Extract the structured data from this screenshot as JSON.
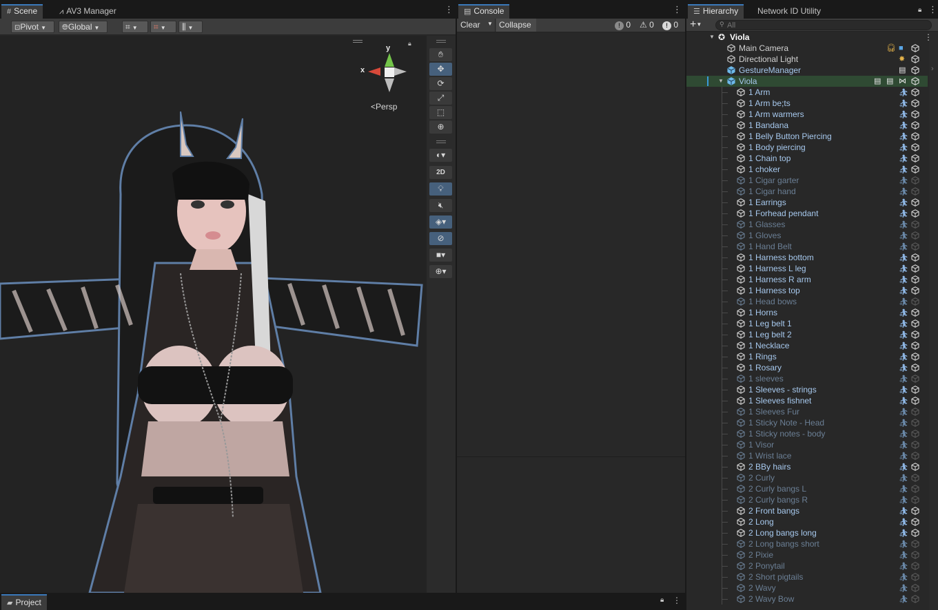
{
  "scene": {
    "tabs": [
      {
        "label": "Scene",
        "icon": "grid-icon"
      },
      {
        "label": "AV3 Manager",
        "icon": "vrc-icon"
      }
    ],
    "toolbar": {
      "pivot": "Pivot",
      "global": "Global"
    },
    "gizmo": {
      "y_label": "y",
      "x_label": "x",
      "projection": "Persp"
    },
    "tools": {
      "mode_2d": "2D"
    }
  },
  "console": {
    "tab": "Console",
    "clear": "Clear",
    "collapse": "Collapse",
    "counts": {
      "info": "0",
      "warning": "0",
      "error": "0"
    }
  },
  "hierarchy": {
    "tabs": [
      "Hierarchy",
      "Network ID Utility"
    ],
    "search_placeholder": "All",
    "scene_name": "Viola",
    "top_items": [
      {
        "label": "Main Camera",
        "style": "normal"
      },
      {
        "label": "Directional Light",
        "style": "normal"
      },
      {
        "label": "GestureManager",
        "style": "active"
      },
      {
        "label": "Viola",
        "style": "active"
      }
    ],
    "children": [
      {
        "label": "1 Arm",
        "on": true
      },
      {
        "label": "1 Arm be;ts",
        "on": true
      },
      {
        "label": "1 Arm warmers",
        "on": true
      },
      {
        "label": "1 Bandana",
        "on": true
      },
      {
        "label": "1 Belly Button Piercing",
        "on": true
      },
      {
        "label": "1 Body piercing",
        "on": true
      },
      {
        "label": "1 Chain top",
        "on": true
      },
      {
        "label": "1 choker",
        "on": true
      },
      {
        "label": "1 Cigar garter",
        "on": false
      },
      {
        "label": "1 Cigar hand",
        "on": false
      },
      {
        "label": "1 Earrings",
        "on": true
      },
      {
        "label": "1 Forhead pendant",
        "on": true
      },
      {
        "label": "1 Glasses",
        "on": false
      },
      {
        "label": "1 Gloves",
        "on": false
      },
      {
        "label": "1 Hand Belt",
        "on": false
      },
      {
        "label": "1 Harness bottom",
        "on": true
      },
      {
        "label": "1 Harness L leg",
        "on": true
      },
      {
        "label": "1 Harness R arm",
        "on": true
      },
      {
        "label": "1 Harness top",
        "on": true
      },
      {
        "label": "1 Head bows",
        "on": false
      },
      {
        "label": "1 Horns",
        "on": true
      },
      {
        "label": "1 Leg belt 1",
        "on": true
      },
      {
        "label": "1 Leg belt 2",
        "on": true
      },
      {
        "label": "1 Necklace",
        "on": true
      },
      {
        "label": "1 Rings",
        "on": true
      },
      {
        "label": "1 Rosary",
        "on": true
      },
      {
        "label": "1 sleeves",
        "on": false
      },
      {
        "label": "1 Sleeves - strings",
        "on": true
      },
      {
        "label": "1 Sleeves fishnet",
        "on": true
      },
      {
        "label": "1 Sleeves Fur",
        "on": false
      },
      {
        "label": "1 Sticky Note - Head",
        "on": false
      },
      {
        "label": "1 Sticky notes - body",
        "on": false
      },
      {
        "label": "1 Visor",
        "on": false
      },
      {
        "label": "1 Wrist lace",
        "on": false
      },
      {
        "label": "2 BBy hairs",
        "on": true
      },
      {
        "label": "2 Curly",
        "on": false
      },
      {
        "label": "2 Curly bangs L",
        "on": false
      },
      {
        "label": "2 Curly bangs R",
        "on": false
      },
      {
        "label": "2 Front bangs",
        "on": true
      },
      {
        "label": "2 Long",
        "on": true
      },
      {
        "label": "2 Long bangs long",
        "on": true
      },
      {
        "label": "2 Long bangs short",
        "on": false
      },
      {
        "label": "2 Pixie",
        "on": false
      },
      {
        "label": "2 Ponytail",
        "on": false
      },
      {
        "label": "2 Short pigtails",
        "on": false
      },
      {
        "label": "2 Wavy",
        "on": false
      },
      {
        "label": "2 Wavy Bow",
        "on": false
      }
    ]
  },
  "project": {
    "tab": "Project"
  },
  "colors": {
    "accent": "#3a79bb",
    "selected_row": "#2f4a33",
    "active_text": "#a7c9ee",
    "inactive_text": "#6b7f95"
  }
}
